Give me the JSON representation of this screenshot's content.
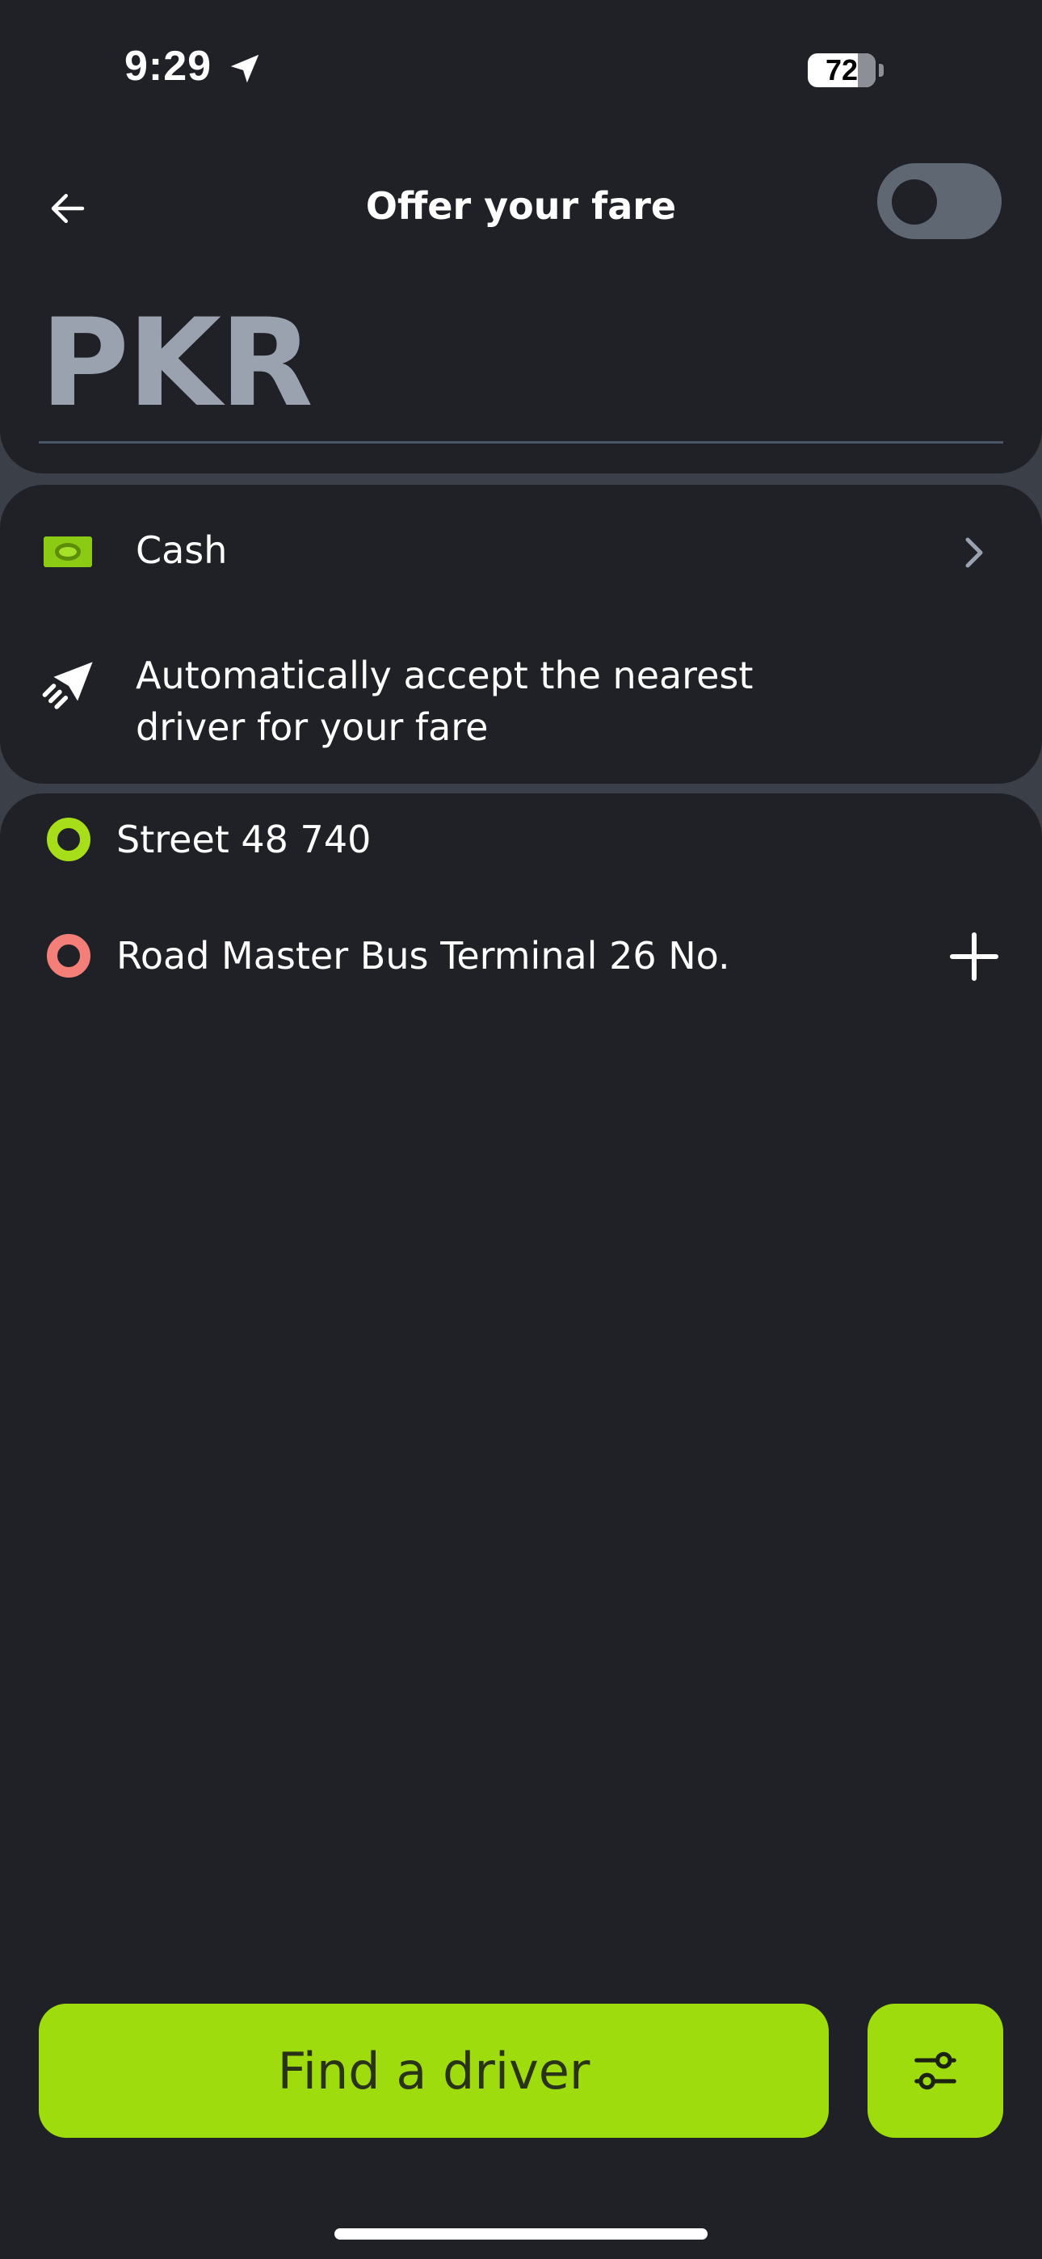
{
  "status_bar": {
    "time": "9:29",
    "battery": "72"
  },
  "header": {
    "title": "Offer your fare"
  },
  "fare": {
    "currency_placeholder": "PKR"
  },
  "payment": {
    "label": "Cash"
  },
  "auto_accept": {
    "label": "Automatically accept the nearest driver for your fare",
    "enabled": false
  },
  "route": {
    "pickup": "Street 48 740",
    "destination": "Road Master Bus Terminal 26 No."
  },
  "actions": {
    "find_driver_label": "Find a driver"
  },
  "colors": {
    "accent": "#9fdc0e",
    "background": "#1f2126",
    "pickup_dot": "#a6df1a",
    "destination_dot": "#f47f79"
  },
  "icons": [
    "location-arrow-icon",
    "back-arrow-icon",
    "cash-icon",
    "chevron-right-icon",
    "paper-plane-icon",
    "plus-icon",
    "filter-icon"
  ]
}
